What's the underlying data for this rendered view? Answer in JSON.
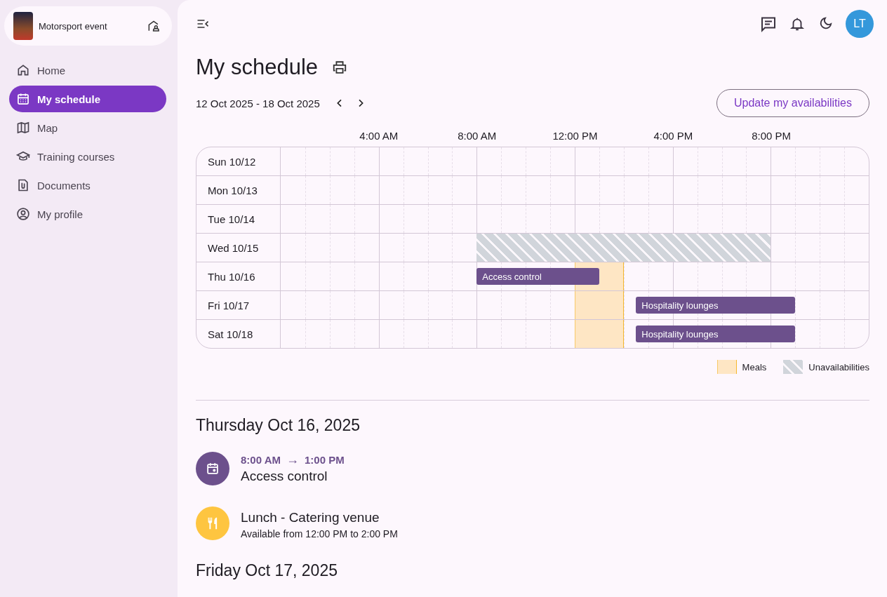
{
  "event": {
    "name": "Motorsport event"
  },
  "nav": [
    {
      "label": "Home",
      "selected": false
    },
    {
      "label": "My schedule",
      "selected": true
    },
    {
      "label": "Map",
      "selected": false
    },
    {
      "label": "Training courses",
      "selected": false
    },
    {
      "label": "Documents",
      "selected": false
    },
    {
      "label": "My profile",
      "selected": false
    }
  ],
  "user": {
    "initials": "LT"
  },
  "page": {
    "title": "My schedule",
    "date_range": "12 Oct 2025 - 18 Oct 2025",
    "update_button": "Update my availabilities"
  },
  "timeline": {
    "hour_labels": [
      "4:00 AM",
      "8:00 AM",
      "12:00 PM",
      "4:00 PM",
      "8:00 PM"
    ],
    "days": [
      {
        "label": "Sun 10/12"
      },
      {
        "label": "Mon 10/13"
      },
      {
        "label": "Tue 10/14"
      },
      {
        "label": "Wed 10/15",
        "blocks": [
          {
            "kind": "unavailable"
          }
        ]
      },
      {
        "label": "Thu 10/16",
        "blocks": [
          {
            "kind": "meal"
          },
          {
            "kind": "shift",
            "label": "Access control"
          }
        ]
      },
      {
        "label": "Fri 10/17",
        "blocks": [
          {
            "kind": "meal"
          },
          {
            "kind": "shift",
            "label": "Hospitality lounges"
          }
        ]
      },
      {
        "label": "Sat 10/18",
        "blocks": [
          {
            "kind": "meal"
          },
          {
            "kind": "shift",
            "label": "Hospitality lounges"
          }
        ]
      }
    ],
    "legend": [
      {
        "kind": "meal",
        "label": "Meals"
      },
      {
        "kind": "unavailable",
        "label": "Unavailabilities"
      }
    ]
  },
  "agenda": [
    {
      "heading": "Thursday Oct 16, 2025",
      "entries": [
        {
          "kind": "shift",
          "from": "8:00 AM",
          "arrow": "→",
          "to": "1:00 PM",
          "title": "Access control"
        },
        {
          "kind": "meal",
          "title": "Lunch - Catering venue",
          "note": "Available from 12:00 PM to 2:00 PM"
        }
      ]
    },
    {
      "heading": "Friday Oct 17, 2025"
    }
  ]
}
